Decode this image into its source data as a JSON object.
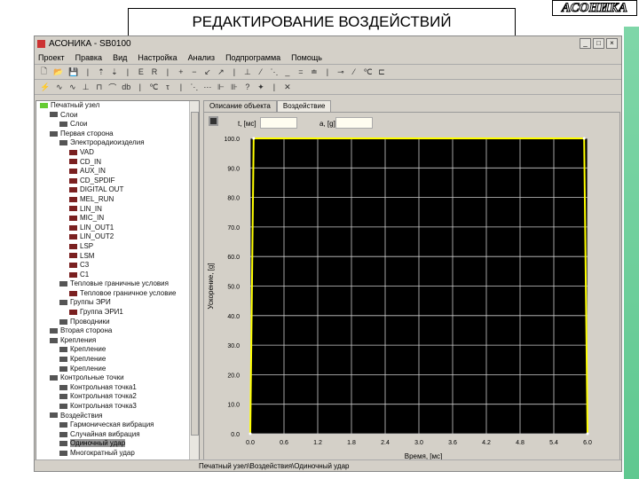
{
  "slide": {
    "title": "РЕДАКТИРОВАНИЕ ВОЗДЕЙСТВИЙ",
    "logo": "АСОНИКА"
  },
  "window": {
    "title": "АСОНИКА - SB0100",
    "buttons": [
      "_",
      "□",
      "×"
    ]
  },
  "menu": [
    "Проект",
    "Правка",
    "Вид",
    "Настройка",
    "Анализ",
    "Подпрограмма",
    "Помощь"
  ],
  "toolbar1": [
    "🗋",
    "📂",
    "💾",
    "|",
    "⇡",
    "⇣",
    "|",
    "E",
    "R",
    "|",
    "+",
    "−",
    "↙",
    "↗",
    "|",
    "⊥",
    "⁄",
    "⋱",
    "_",
    "=",
    "≐",
    "|",
    "⊸",
    "⁄",
    "℃",
    "⊏"
  ],
  "toolbar2": [
    "⚡",
    "∿",
    "∿",
    "⊥",
    "⊓",
    "⌒",
    "db",
    "|",
    "℃",
    "τ",
    "|",
    "⋱",
    "⋯",
    "⊩",
    "⊪",
    "?",
    "✦",
    "|",
    "✕"
  ],
  "tree": [
    {
      "l": 0,
      "t": "Печатный узел"
    },
    {
      "l": 1,
      "t": "Слои"
    },
    {
      "l": 2,
      "t": "Слои"
    },
    {
      "l": 1,
      "t": "Первая сторона"
    },
    {
      "l": 2,
      "t": "Электрорадиоизделия"
    },
    {
      "l": 3,
      "t": "VAD"
    },
    {
      "l": 3,
      "t": "CD_IN"
    },
    {
      "l": 3,
      "t": "AUX_IN"
    },
    {
      "l": 3,
      "t": "CD_SPDIF"
    },
    {
      "l": 3,
      "t": "DIGITAL OUT"
    },
    {
      "l": 3,
      "t": "MEL_RUN"
    },
    {
      "l": 3,
      "t": "LIN_IN"
    },
    {
      "l": 3,
      "t": "MIC_IN"
    },
    {
      "l": 3,
      "t": "LIN_OUT1"
    },
    {
      "l": 3,
      "t": "LIN_OUT2"
    },
    {
      "l": 3,
      "t": "LSP"
    },
    {
      "l": 3,
      "t": "LSM"
    },
    {
      "l": 3,
      "t": "C3"
    },
    {
      "l": 3,
      "t": "C1"
    },
    {
      "l": 2,
      "t": "Тепловые граничные условия"
    },
    {
      "l": 3,
      "t": "Тепловое граничное условие"
    },
    {
      "l": 2,
      "t": "Группы ЭРИ"
    },
    {
      "l": 3,
      "t": "Группа ЭРИ1"
    },
    {
      "l": 2,
      "t": "Проводники"
    },
    {
      "l": 1,
      "t": "Вторая сторона"
    },
    {
      "l": 1,
      "t": "Крепления"
    },
    {
      "l": 2,
      "t": "Крепление"
    },
    {
      "l": 2,
      "t": "Крепление"
    },
    {
      "l": 2,
      "t": "Крепление"
    },
    {
      "l": 1,
      "t": "Контрольные точки"
    },
    {
      "l": 2,
      "t": "Контрольная точка1"
    },
    {
      "l": 2,
      "t": "Контрольная точка2"
    },
    {
      "l": 2,
      "t": "Контрольная точка3"
    },
    {
      "l": 1,
      "t": "Воздействия"
    },
    {
      "l": 2,
      "t": "Гармоническая вибрация"
    },
    {
      "l": 2,
      "t": "Случайная вибрация"
    },
    {
      "l": 2,
      "t": "Одиночный удар",
      "selected": true
    },
    {
      "l": 2,
      "t": "Многократный удар"
    }
  ],
  "tabs": [
    {
      "label": "Описание объекта"
    },
    {
      "label": "Воздействие",
      "active": true
    }
  ],
  "fields": {
    "t_label": "t, [мс]",
    "t_value": "",
    "a_label": "a, [g]",
    "a_value": ""
  },
  "status": "Печатный узел\\Воздействия\\Одиночный удар",
  "chart_data": {
    "type": "line",
    "title": "",
    "xlabel": "Время, [мс]",
    "ylabel": "Ускорение, [g]",
    "xlim": [
      0,
      6
    ],
    "ylim": [
      0,
      100
    ],
    "xticks": [
      "0.0",
      "0.6",
      "1.2",
      "1.8",
      "2.4",
      "3.0",
      "3.6",
      "4.2",
      "4.8",
      "5.4",
      "6.0"
    ],
    "yticks": [
      "0.0",
      "10.0",
      "20.0",
      "30.0",
      "40.0",
      "50.0",
      "60.0",
      "70.0",
      "80.0",
      "90.0",
      "100.0"
    ],
    "grid": true,
    "series": [
      {
        "name": "Одиночный удар",
        "color": "#ffff00",
        "x": [
          0,
          0.06,
          5.94,
          6.0
        ],
        "y": [
          0,
          100,
          100,
          0
        ]
      }
    ]
  }
}
